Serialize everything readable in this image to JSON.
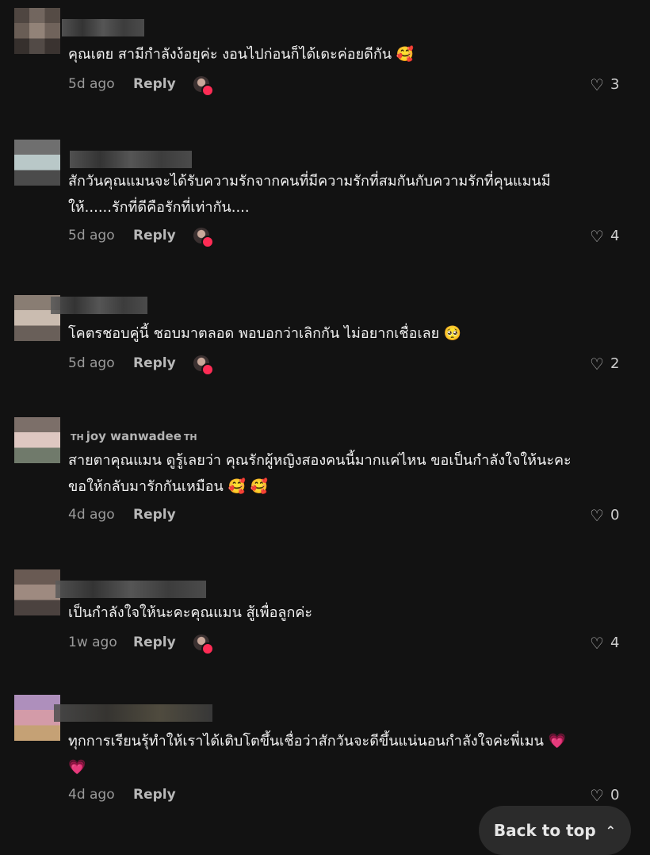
{
  "comments": [
    {
      "username": "",
      "text": "คุณเตย สามีกำลังง้อยุค่ะ งอนไปก่อนก็ได้เดะค่อยดีกัน",
      "emoji": "🥰",
      "time": "5d ago",
      "reply": "Reply",
      "likes": "3"
    },
    {
      "username": "",
      "text": "สักวันคุณแมนจะได้รับความรักจากคนที่มีความรักที่สมกันกับความรักที่คุนแมนมีให้......รักที่ดีคือรักที่เท่ากัน....",
      "emoji": "",
      "time": "5d ago",
      "reply": "Reply",
      "likes": "4"
    },
    {
      "username": "",
      "text": "โคตรชอบคู่นี้ ชอบมาตลอด พอบอกว่าเลิกกัน ไม่อยากเชื่อเลย",
      "emoji": "🥺",
      "time": "5d ago",
      "reply": "Reply",
      "likes": "2"
    },
    {
      "username": "joy wanwadee",
      "flag_left": "TH",
      "flag_right": "TH",
      "text": "สายตาคุณแมน ดูรู้เลยว่า คุณรักผู้หญิงสองคนนี้มากแค่ไหน ขอเป็นกำลังใจให้นะคะ ขอให้กลับมารักกันเหมือน",
      "emoji": "🥰 🥰",
      "time": "4d ago",
      "reply": "Reply",
      "likes": "0"
    },
    {
      "username": "",
      "text": "เป็นกำลังใจให้นะคะคุณแมน สู้เพื่อลูกค่ะ",
      "emoji": "",
      "time": "1w ago",
      "reply": "Reply",
      "likes": "4"
    },
    {
      "username": "",
      "text": "ทุกการเรียนรุ้ทำให้เราได้เติบโตขึ้นเชื่อว่าสักวันจะดีขึ้นแน่นอนกำลังใจค่ะพี่เมน",
      "emoji": "💗 💗",
      "time": "4d ago",
      "reply": "Reply",
      "likes": "0"
    }
  ],
  "back_to_top": {
    "label": "Back to top",
    "icon": "double-chevron-up-icon"
  },
  "colors": {
    "background": "#121212",
    "text": "#f1f1f2",
    "muted": "#9a9a9a",
    "creator_badge": "#fe2c55"
  }
}
